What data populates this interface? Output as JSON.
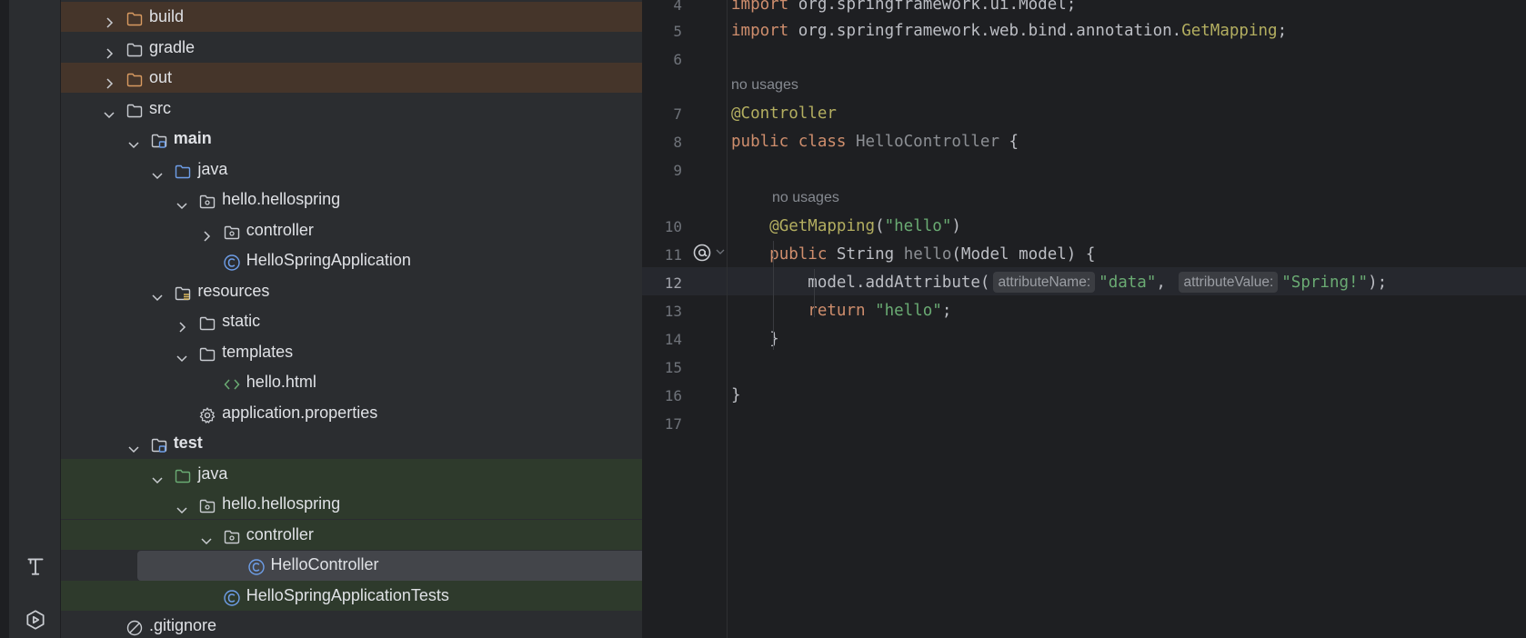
{
  "project_tree": {
    "rows": [
      {
        "label": "build",
        "bold": false,
        "chevron": "right",
        "icon": "folder-orange-icon",
        "indent": 0,
        "style": "excluded"
      },
      {
        "label": "gradle",
        "bold": false,
        "chevron": "right",
        "icon": "folder-icon",
        "indent": 0,
        "style": ""
      },
      {
        "label": "out",
        "bold": false,
        "chevron": "right",
        "icon": "folder-orange-icon",
        "indent": 0,
        "style": "excluded"
      },
      {
        "label": "src",
        "bold": false,
        "chevron": "down",
        "icon": "folder-icon",
        "indent": 0,
        "style": ""
      },
      {
        "label": "main",
        "bold": true,
        "chevron": "down",
        "icon": "module-folder-icon",
        "indent": 1,
        "style": ""
      },
      {
        "label": "java",
        "bold": false,
        "chevron": "down",
        "icon": "folder-blue-icon",
        "indent": 2,
        "style": ""
      },
      {
        "label": "hello.hellospring",
        "bold": false,
        "chevron": "down",
        "icon": "package-icon",
        "indent": 3,
        "style": ""
      },
      {
        "label": "controller",
        "bold": false,
        "chevron": "right",
        "icon": "package-icon",
        "indent": 4,
        "style": ""
      },
      {
        "label": "HelloSpringApplication",
        "bold": false,
        "chevron": "none",
        "icon": "class-icon",
        "indent": 4,
        "style": ""
      },
      {
        "label": "resources",
        "bold": false,
        "chevron": "down",
        "icon": "resources-folder-icon",
        "indent": 2,
        "style": ""
      },
      {
        "label": "static",
        "bold": false,
        "chevron": "right",
        "icon": "folder-icon",
        "indent": 3,
        "style": ""
      },
      {
        "label": "templates",
        "bold": false,
        "chevron": "down",
        "icon": "folder-icon",
        "indent": 3,
        "style": ""
      },
      {
        "label": "hello.html",
        "bold": false,
        "chevron": "none",
        "icon": "html-icon",
        "indent": 4,
        "style": ""
      },
      {
        "label": "application.properties",
        "bold": false,
        "chevron": "none",
        "icon": "gear-icon",
        "indent": 3,
        "style": ""
      },
      {
        "label": "test",
        "bold": true,
        "chevron": "down",
        "icon": "module-folder-icon",
        "indent": 1,
        "style": ""
      },
      {
        "label": "java",
        "bold": false,
        "chevron": "down",
        "icon": "folder-green-icon",
        "indent": 2,
        "style": "test-root"
      },
      {
        "label": "hello.hellospring",
        "bold": false,
        "chevron": "down",
        "icon": "package-icon",
        "indent": 3,
        "style": "test-root"
      },
      {
        "label": "controller",
        "bold": false,
        "chevron": "down",
        "icon": "package-icon",
        "indent": 4,
        "style": "test-root"
      },
      {
        "label": "HelloController",
        "bold": false,
        "chevron": "none",
        "icon": "class-icon",
        "indent": 5,
        "style": "test-root",
        "selected": true
      },
      {
        "label": "HelloSpringApplicationTests",
        "bold": false,
        "chevron": "none",
        "icon": "class-icon",
        "indent": 4,
        "style": "test-root"
      },
      {
        "label": ".gitignore",
        "bold": false,
        "chevron": "none",
        "icon": "ignore-icon",
        "indent": 0,
        "style": ""
      }
    ]
  },
  "editor": {
    "lines": [
      {
        "n": "4",
        "parts": [
          [
            "kw",
            "import "
          ],
          [
            "plain",
            "org.springframework.ui.Model;"
          ]
        ]
      },
      {
        "n": "5",
        "parts": [
          [
            "kw",
            "import "
          ],
          [
            "plain",
            "org.springframework.web.bind.annotation."
          ],
          [
            "ann",
            "GetMapping"
          ],
          [
            "plain",
            ";"
          ]
        ]
      },
      {
        "n": "6",
        "parts": []
      },
      {
        "n": "7",
        "parts": [
          [
            "ann",
            "@Controller"
          ]
        ]
      },
      {
        "n": "8",
        "parts": [
          [
            "kw",
            "public class "
          ],
          [
            "dim",
            "HelloController"
          ],
          [
            "plain",
            " {"
          ]
        ]
      },
      {
        "n": "9",
        "parts": []
      },
      {
        "n": "10",
        "parts": [
          [
            "plain",
            "    "
          ],
          [
            "ann",
            "@GetMapping"
          ],
          [
            "plain",
            "("
          ],
          [
            "str",
            "\"hello\""
          ],
          [
            "plain",
            ")"
          ]
        ]
      },
      {
        "n": "11",
        "parts": [
          [
            "plain",
            "    "
          ],
          [
            "kw",
            "public "
          ],
          [
            "plain",
            "String "
          ],
          [
            "dim",
            "hello"
          ],
          [
            "plain",
            "(Model model) {"
          ]
        ]
      },
      {
        "n": "12",
        "parts": [
          [
            "plain",
            "        model.addAttribute("
          ],
          [
            "inlay",
            "attributeName:"
          ],
          [
            "str",
            "\"data\""
          ],
          [
            "plain",
            ", "
          ],
          [
            "inlay",
            "attributeValue:"
          ],
          [
            "str",
            "\"Spring!\""
          ],
          [
            "plain",
            ");"
          ]
        ]
      },
      {
        "n": "13",
        "parts": [
          [
            "plain",
            "        "
          ],
          [
            "kw",
            "return "
          ],
          [
            "str",
            "\"hello\""
          ],
          [
            "plain",
            ";"
          ]
        ]
      },
      {
        "n": "14",
        "parts": [
          [
            "plain",
            "    }"
          ]
        ]
      },
      {
        "n": "15",
        "parts": []
      },
      {
        "n": "16",
        "parts": [
          [
            "plain",
            "}"
          ]
        ]
      },
      {
        "n": "17",
        "parts": []
      }
    ],
    "usage_hints": [
      "no usages",
      "no usages"
    ],
    "active_line": "12"
  },
  "colors": {
    "keyword": "#cf8e6d",
    "annotation": "#b3ae60",
    "string": "#6aab73",
    "text": "#bcbec4",
    "excluded_bg": "#45352a",
    "test_bg": "#2e3a2c",
    "selection": "#43454a"
  }
}
